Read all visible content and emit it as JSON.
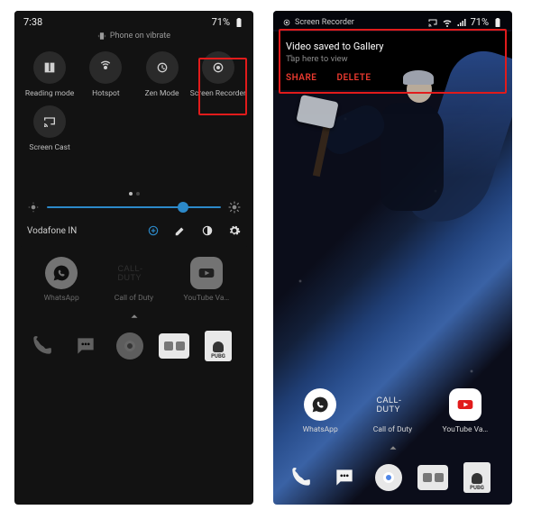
{
  "left": {
    "status": {
      "time": "7:38",
      "battery_pct": "71%"
    },
    "vibrate_text": "Phone on vibrate",
    "tiles": [
      {
        "id": "reading-mode",
        "label": "Reading mode"
      },
      {
        "id": "hotspot",
        "label": "Hotspot"
      },
      {
        "id": "zen-mode",
        "label": "Zen Mode"
      },
      {
        "id": "screen-recorder",
        "label": "Screen Recorder"
      },
      {
        "id": "screen-cast",
        "label": "Screen Cast"
      }
    ],
    "brightness_pct": 78,
    "carrier": "Vodafone IN",
    "apps": [
      {
        "id": "whatsapp",
        "label": "WhatsApp"
      },
      {
        "id": "cod",
        "label": "Call of Duty",
        "word": "CALL-DUTY"
      },
      {
        "id": "youtube",
        "label": "YouTube Va…"
      }
    ],
    "dock": [
      "phone",
      "messages",
      "chrome",
      "gallery",
      "pubg"
    ]
  },
  "right": {
    "status": {
      "notif_text": "Screen Recorder",
      "battery_pct": "71%"
    },
    "notification": {
      "title": "Video saved to Gallery",
      "subtitle": "Tap here to view",
      "share": "SHARE",
      "delete": "DELETE"
    },
    "apps": [
      {
        "id": "whatsapp",
        "label": "WhatsApp"
      },
      {
        "id": "cod",
        "label": "Call of Duty",
        "word": "CALL-DUTY"
      },
      {
        "id": "youtube",
        "label": "YouTube Va…"
      }
    ],
    "dock": [
      "phone",
      "messages",
      "chrome",
      "gallery",
      "pubg"
    ],
    "pubg_label": "PUBG"
  },
  "colors": {
    "accent": "#2c89c9",
    "danger": "#ec3a2f",
    "highlight": "#e11b1b"
  }
}
